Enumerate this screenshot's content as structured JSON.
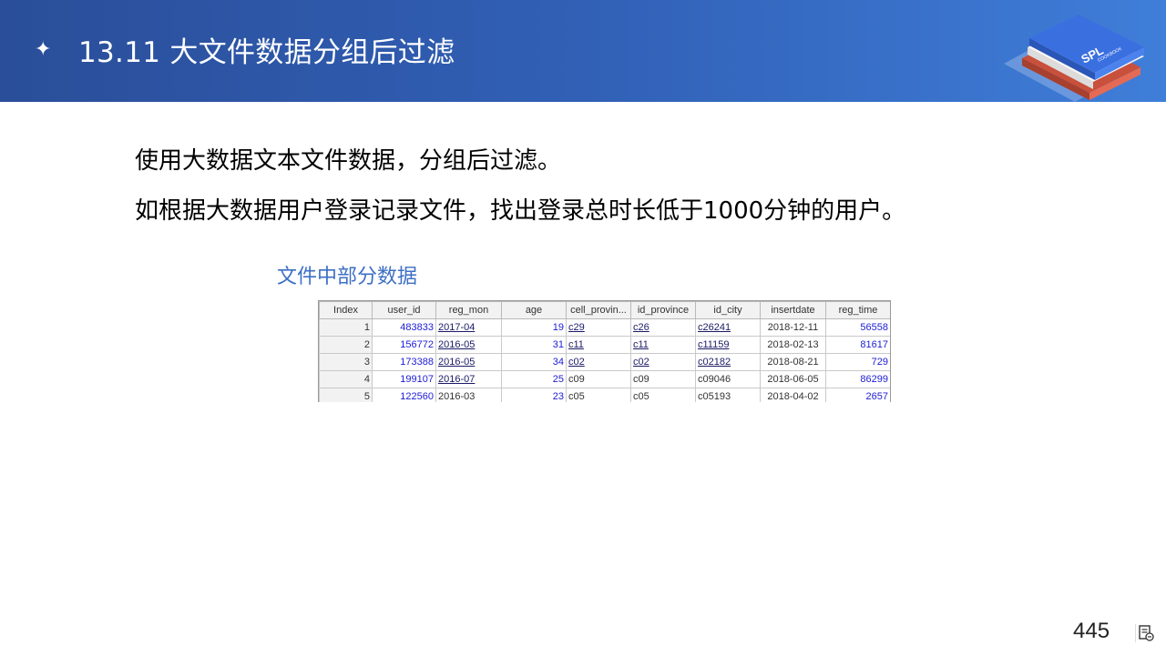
{
  "header": {
    "title": "13.11 大文件数据分组后过滤",
    "bullet_icon": "sparkle-icon",
    "logo_text": "SPL",
    "logo_subtext": "COOKBOOK"
  },
  "content": {
    "line1": "使用大数据文本文件数据，分组后过滤。",
    "line2": "如根据大数据用户登录记录文件，找出登录总时长低于1000分钟的用户。",
    "caption": "文件中部分数据"
  },
  "table": {
    "columns": [
      "Index",
      "user_id",
      "reg_mon",
      "age",
      "cell_provin...",
      "id_province",
      "id_city",
      "insertdate",
      "reg_time"
    ],
    "rows": [
      [
        "1",
        "483833",
        "2017-04",
        "19",
        "c29",
        "c26",
        "c26241",
        "2018-12-11",
        "56558"
      ],
      [
        "2",
        "156772",
        "2016-05",
        "31",
        "c11",
        "c11",
        "c11159",
        "2018-02-13",
        "81617"
      ],
      [
        "3",
        "173388",
        "2016-05",
        "34",
        "c02",
        "c02",
        "c02182",
        "2018-08-21",
        "729"
      ],
      [
        "4",
        "199107",
        "2016-07",
        "25",
        "c09",
        "c09",
        "c09046",
        "2018-06-05",
        "86299"
      ],
      [
        "5",
        "122560",
        "2016-03",
        "23",
        "c05",
        "c05",
        "c05193",
        "2018-04-02",
        "2657"
      ]
    ]
  },
  "footer": {
    "page_number": "445",
    "notes_icon": "notes-icon"
  },
  "colors": {
    "header_start": "#2a4e99",
    "header_end": "#3f7ed9",
    "caption": "#3d6fc4",
    "number_blue": "#1c1cd6"
  }
}
